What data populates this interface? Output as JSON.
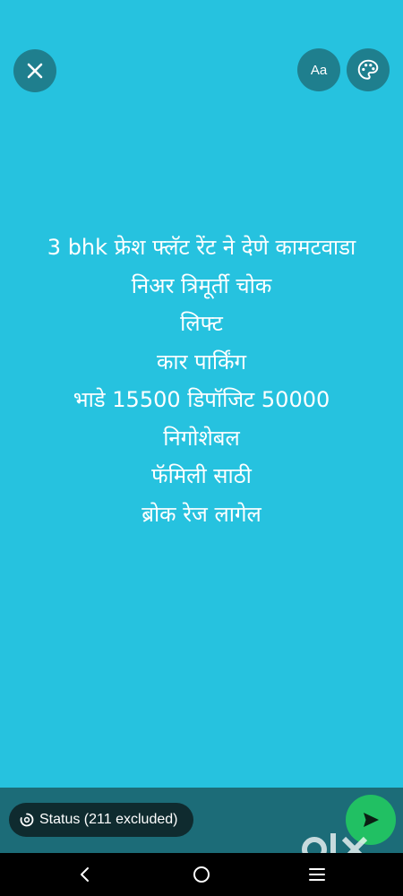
{
  "top_bar": {
    "close_icon": "close-icon",
    "font_button_label": "Aa",
    "palette_icon": "palette-icon"
  },
  "message": {
    "lines": [
      "3 bhk फ्रेश फ्लॅट रेंट ने देणे कामटवाडा",
      "निअर त्रिमूर्ती चोक",
      "लिफ्ट",
      "कार पार्किंग",
      "भाडे 15500 डिपॉजिट 50000",
      "निगोशेबल",
      "फॅमिली साठी",
      "ब्रोक रेज लागेल"
    ]
  },
  "status_chip": {
    "label": "Status (211 excluded)",
    "icon": "status-ring-icon"
  },
  "send_icon": "send-icon",
  "watermark": {
    "text": "olx"
  },
  "colors": {
    "background": "#26C2DF",
    "button_bg": "#1F7F8E",
    "bottom_bar": "#1C6C78",
    "chip_bg": "#0F2B2F",
    "send_green": "#21C063"
  }
}
